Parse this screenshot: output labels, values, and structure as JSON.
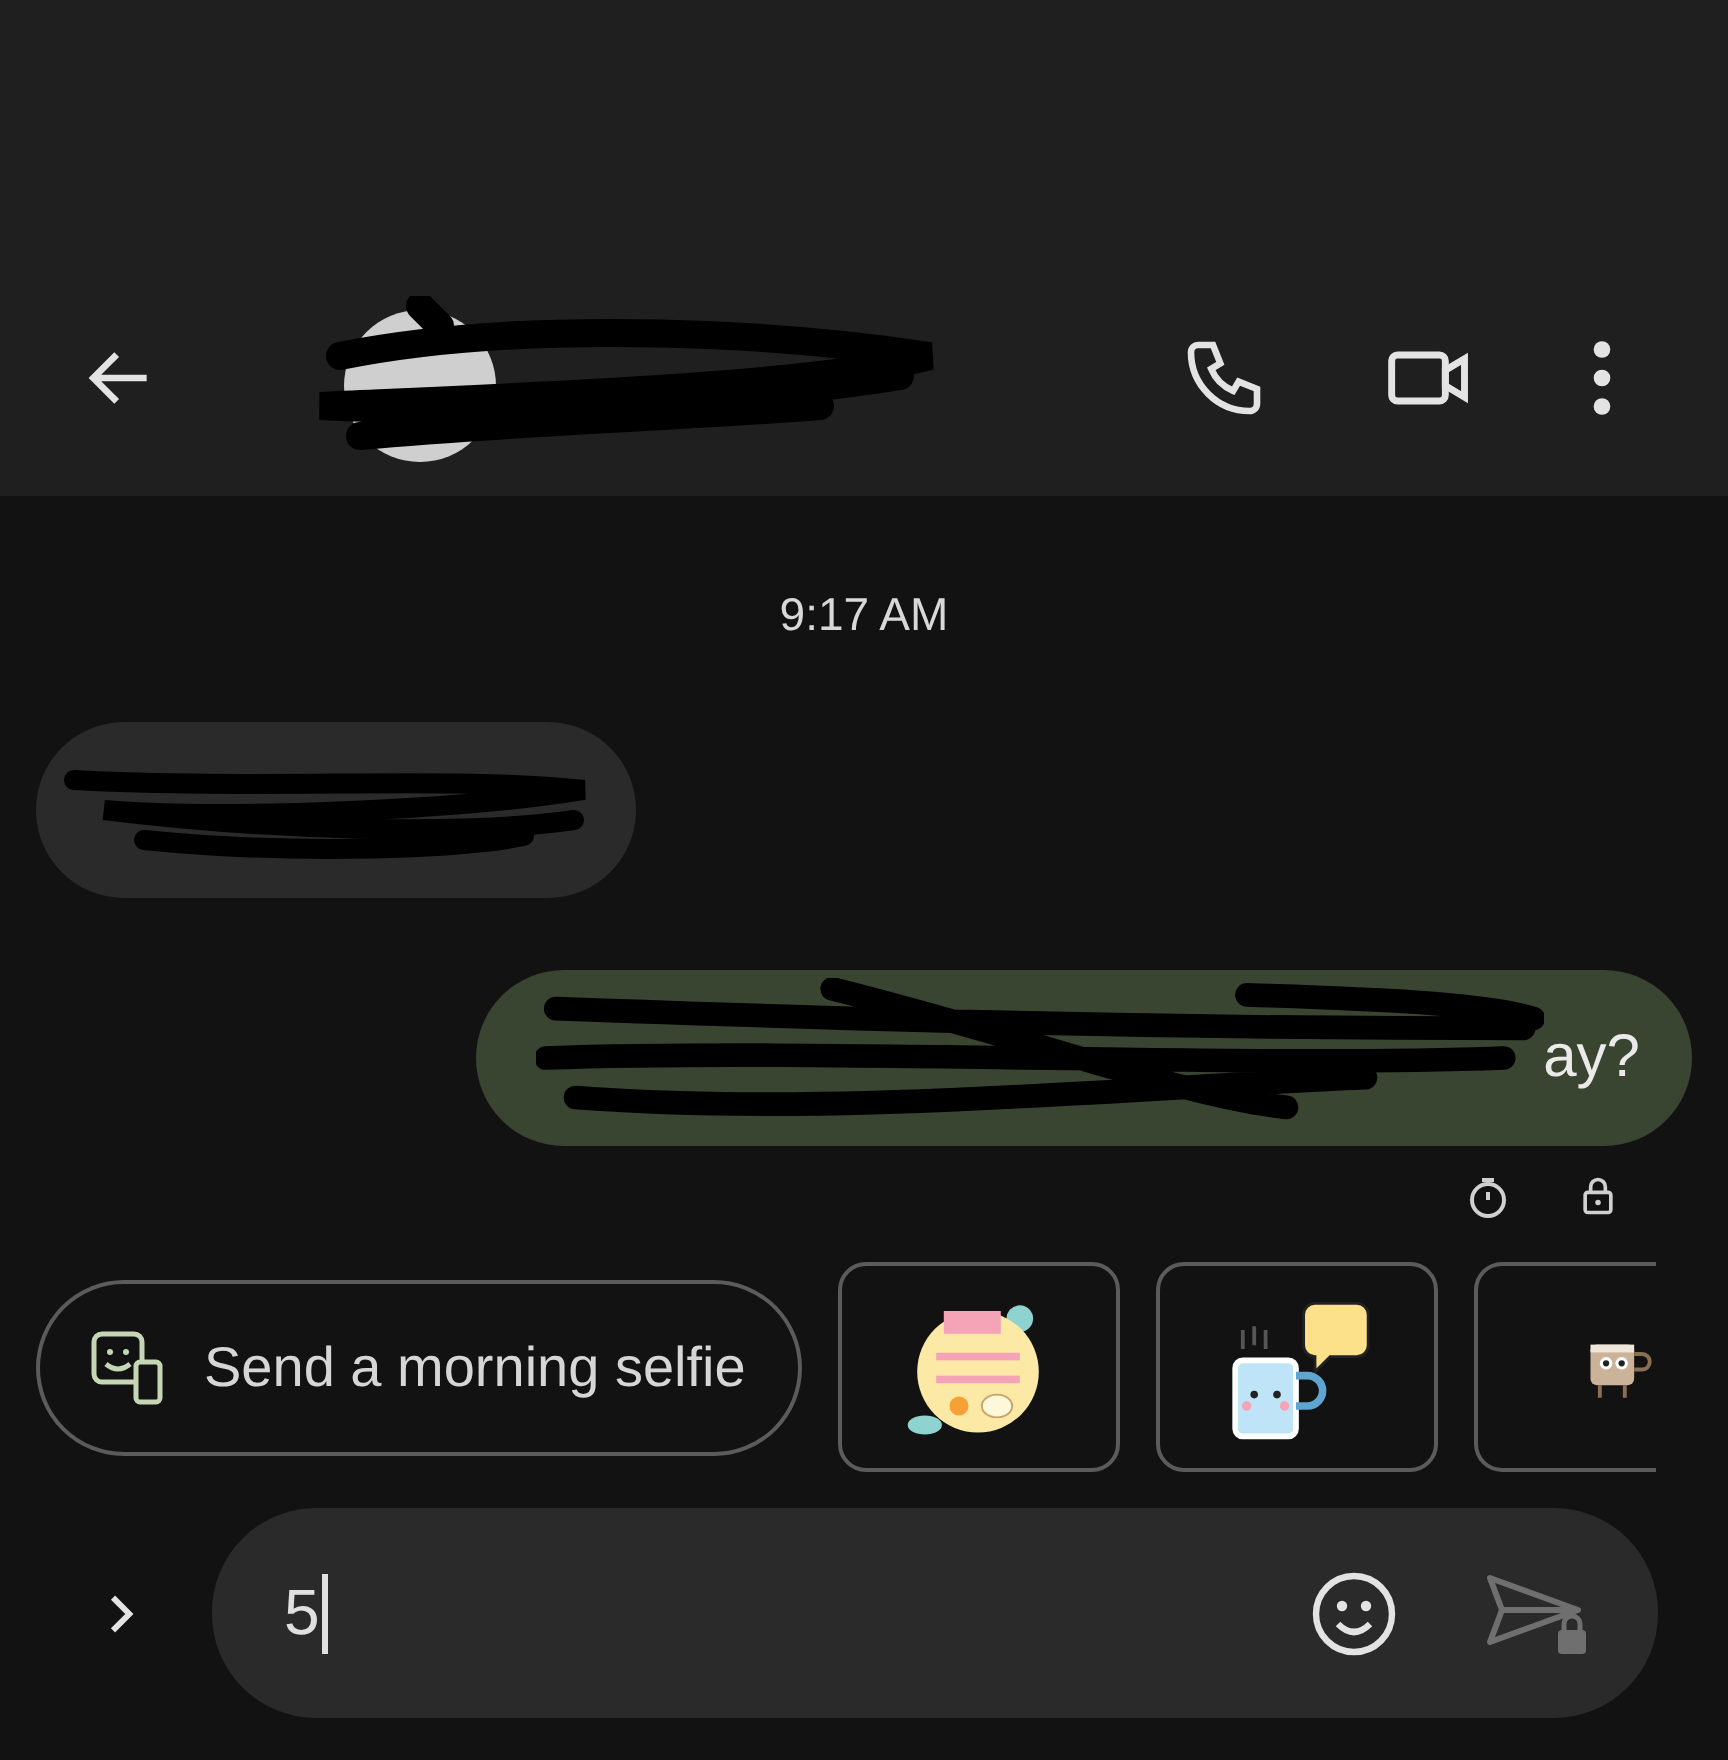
{
  "timestamp": "9:17 AM",
  "messages": [
    {
      "kind": "received"
    },
    {
      "kind": "sent",
      "text": "ay?"
    }
  ],
  "suggestion": {
    "label": "Send a morning selfie"
  },
  "stickers": [
    {
      "kind": "cookie"
    },
    {
      "kind": "mug"
    },
    {
      "kind": "cup"
    }
  ],
  "composer": {
    "value": "5"
  }
}
